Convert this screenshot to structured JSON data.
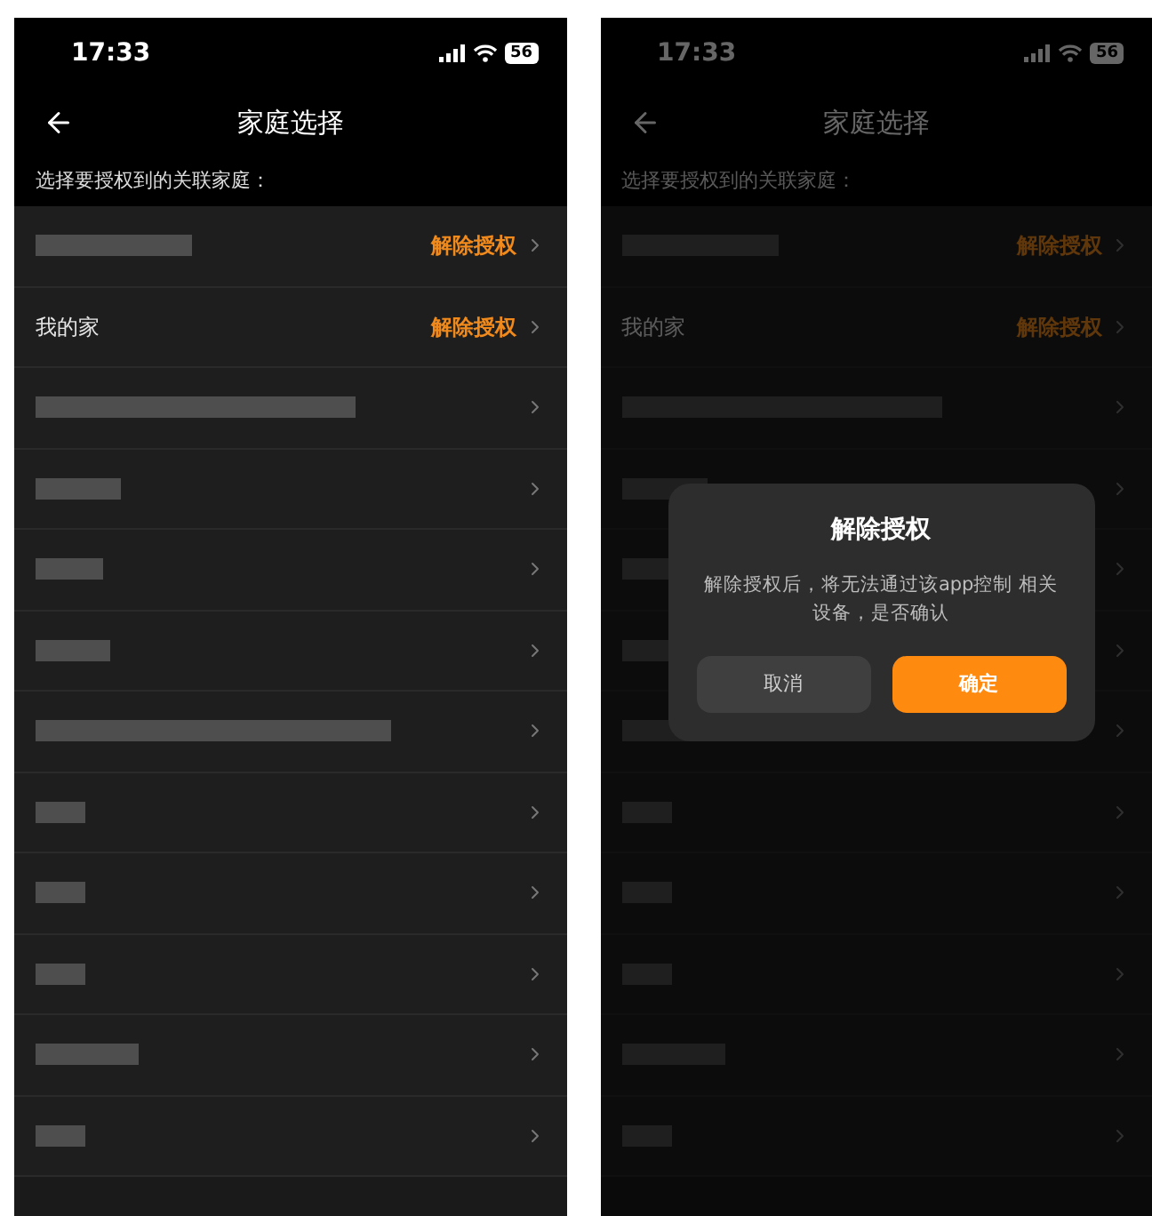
{
  "screens": [
    {
      "dimmed": false,
      "status_bar": {
        "time": "17:33",
        "battery": "56"
      },
      "header": {
        "title": "家庭选择"
      },
      "subtitle": "选择要授权到的关联家庭：",
      "rows": [
        {
          "kind": "blurred",
          "action": "解除授权"
        },
        {
          "kind": "named",
          "name": "我的家",
          "action": "解除授权"
        },
        {
          "kind": "blurred"
        },
        {
          "kind": "blurred"
        },
        {
          "kind": "blurred"
        },
        {
          "kind": "blurred"
        },
        {
          "kind": "blurred"
        },
        {
          "kind": "blurred"
        },
        {
          "kind": "blurred"
        },
        {
          "kind": "blurred"
        },
        {
          "kind": "blurred"
        },
        {
          "kind": "blurred"
        }
      ]
    },
    {
      "dimmed": true,
      "status_bar": {
        "time": "17:33",
        "battery": "56"
      },
      "header": {
        "title": "家庭选择"
      },
      "subtitle": "选择要授权到的关联家庭：",
      "rows": [
        {
          "kind": "blurred",
          "action": "解除授权"
        },
        {
          "kind": "named",
          "name": "我的家",
          "action": "解除授权"
        },
        {
          "kind": "blurred"
        },
        {
          "kind": "blurred"
        },
        {
          "kind": "blurred"
        },
        {
          "kind": "blurred"
        },
        {
          "kind": "blurred"
        },
        {
          "kind": "blurred"
        },
        {
          "kind": "blurred"
        },
        {
          "kind": "blurred"
        },
        {
          "kind": "blurred"
        },
        {
          "kind": "blurred"
        }
      ],
      "dialog": {
        "title": "解除授权",
        "message": "解除授权后，将无法通过该app控制 相关设备，是否确认",
        "cancel": "取消",
        "confirm": "确定"
      }
    }
  ]
}
